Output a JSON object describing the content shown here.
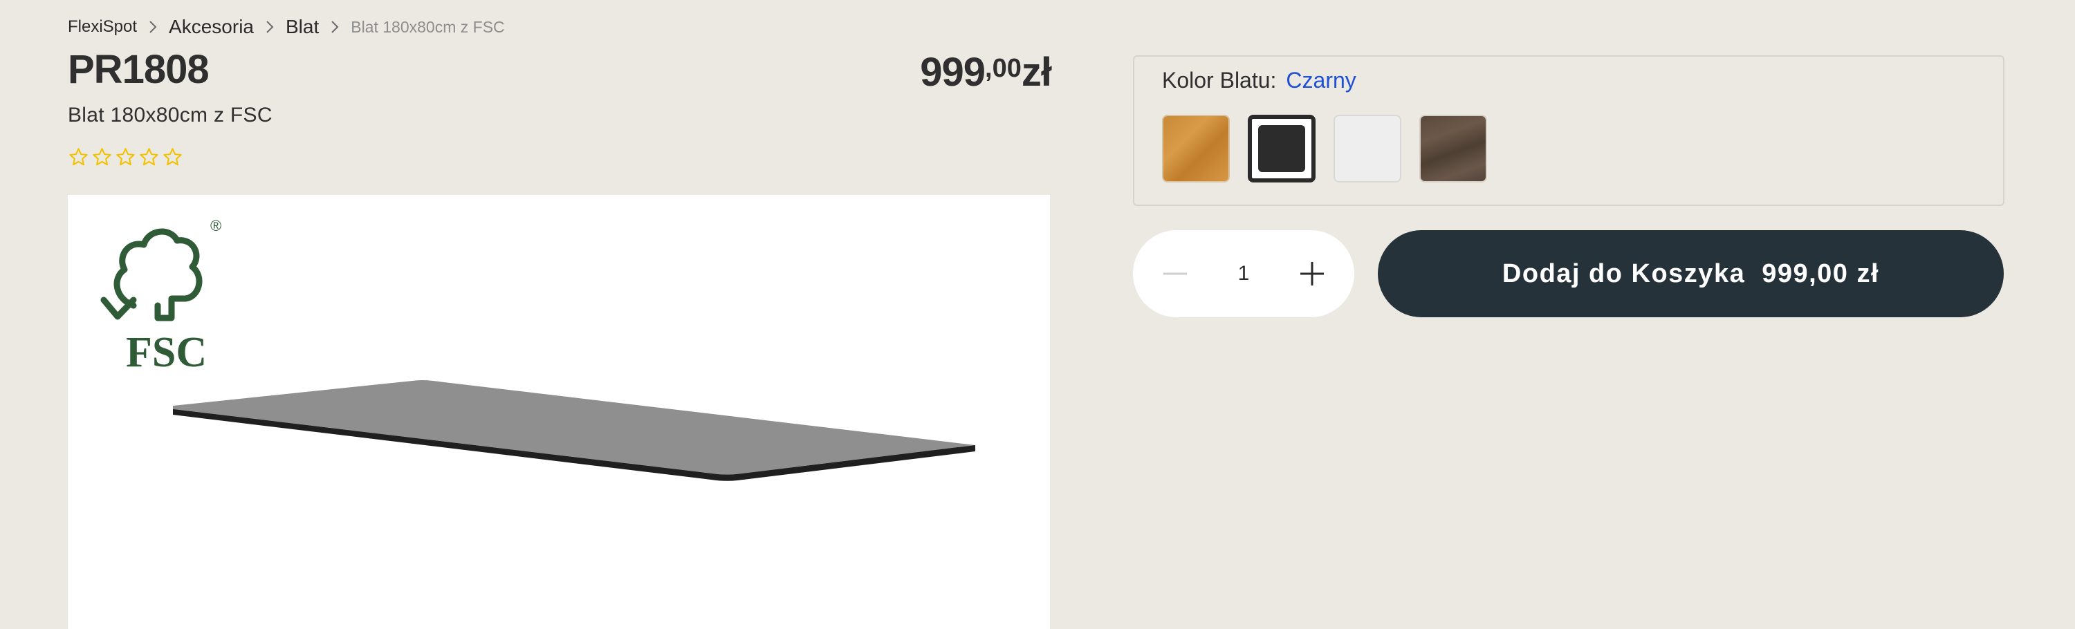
{
  "breadcrumb": {
    "items": [
      "FlexiSpot",
      "Akcesoria",
      "Blat"
    ],
    "current": "Blat 180x80cm z FSC"
  },
  "product": {
    "title": "PR1808",
    "subtitle": "Blat 180x80cm z FSC",
    "rating": {
      "stars_filled": 0,
      "stars_total": 5
    },
    "price": {
      "integer": "999",
      "decimal": ",00",
      "currency": "zł"
    }
  },
  "image": {
    "logo_text": "FSC",
    "logo_mark": "®",
    "alt": "black desktop top"
  },
  "color_selector": {
    "label": "Kolor Blatu:",
    "selected_value": "Czarny",
    "swatches": [
      {
        "name": "oak",
        "color": "#c98a36",
        "selected": false
      },
      {
        "name": "black",
        "color": "#2c2c2c",
        "selected": true
      },
      {
        "name": "white",
        "color": "#eeeeee",
        "selected": false
      },
      {
        "name": "walnut",
        "color": "#5e4c3e",
        "selected": false
      }
    ],
    "accent_color": "#1f4fd6"
  },
  "cart": {
    "quantity": "1",
    "button_label": "Dodaj do Koszyka",
    "button_price": "999,00 zł",
    "button_color": "#26323a"
  },
  "colors": {
    "background": "#ece9e3",
    "star_outline": "#f2c200",
    "fsc_green": "#2f5b37"
  }
}
